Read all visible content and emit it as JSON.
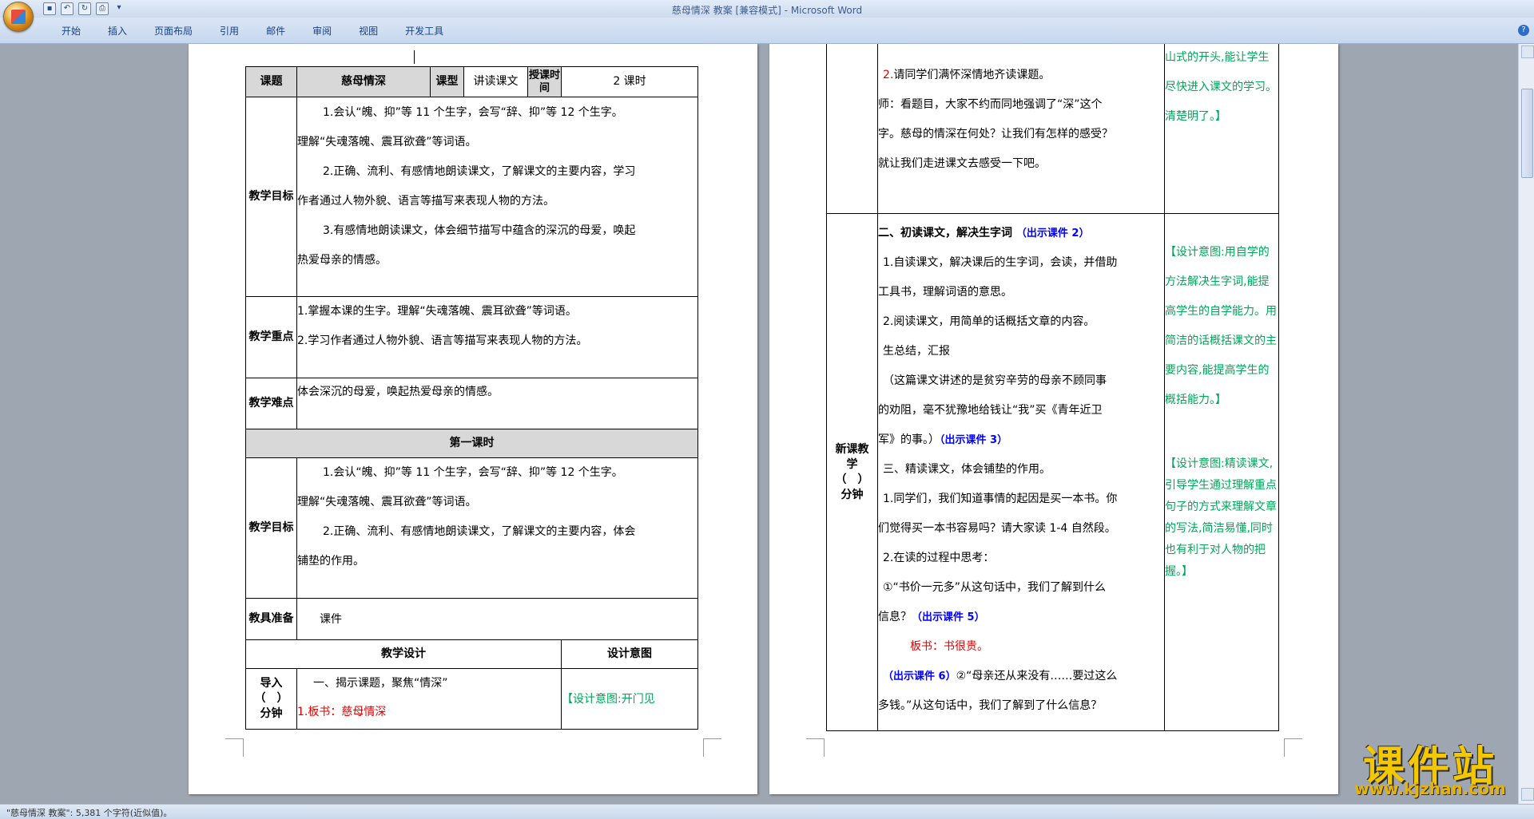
{
  "app": {
    "window_title": "慈母情深 教案 [兼容模式] - Microsoft Word",
    "tabs": [
      "开始",
      "插入",
      "页面布局",
      "引用",
      "邮件",
      "审阅",
      "视图",
      "开发工具"
    ],
    "help": "?",
    "status": "\"慈母情深 教案\": 5,381 个字符(近似值)。"
  },
  "watermark": {
    "cn": "课件站",
    "url": "www.kjzhan.com"
  },
  "left": {
    "header": {
      "c1": "课题",
      "c2": "慈母情深",
      "c3": "课型",
      "c4": "讲读课文",
      "c5": "授课时间",
      "c6": "2 课时"
    },
    "goals_label": "教学目标",
    "goals": [
      "1.会认“魄、抑”等 11 个生字，会写“辞、抑”等 12 个生字。",
      "理解“失魂落魄、震耳欲聋”等词语。",
      "2.正确、流利、有感情地朗读课文，了解课文的主要内容，学习",
      "作者通过人物外貌、语言等描写来表现人物的方法。",
      "3.有感情地朗读课文，体会细节描写中蕴含的深沉的母爱，唤起",
      "热爱母亲的情感。"
    ],
    "key_label": "教学重点",
    "key": [
      "1.掌握本课的生字。理解“失魂落魄、震耳欲聋”等词语。",
      "2.学习作者通过人物外貌、语言等描写来表现人物的方法。"
    ],
    "diff_label": "教学难点",
    "diff": "体会深沉的母爱，唤起热爱母亲的情感。",
    "lesson1": "第一课时",
    "goals2_label": "教学目标",
    "goals2": [
      "1.会认“魄、抑”等 11 个生字，会写“辞、抑”等 12 个生字。",
      "理解“失魂落魄、震耳欲聋”等词语。",
      "2.正确、流利、有感情地朗读课文，了解课文的主要内容，体会",
      "铺垫的作用。"
    ],
    "tools_label": "教具准备",
    "tools": "课件",
    "design_label": "教学设计",
    "intent_label": "设计意图",
    "intro_label": "导入（　）分钟",
    "intro_text": "一、揭示课题，聚焦“情深”",
    "intro_num": "1.",
    "intro_board": "板书：慈母情深",
    "intro_intent": "【设计意图:开门见"
  },
  "right": {
    "top_num": "2.",
    "top_lines": [
      "请同学们满怀深情地齐读课题。",
      "师：看题目，大家不约而同地强调了“深”这个",
      "字。慈母的情深在何处？让我们有怎样的感受？",
      "就让我们走进课文去感受一下吧。"
    ],
    "top_intent": "山式的开头,能让学生尽快进入课文的学习。清楚明了。】",
    "new_label": "新课教学（　）分钟",
    "sec2_title": "二、初读课文，解决生字词",
    "sec2_tag": "（出示课件 2）",
    "sec2_lines": [
      "1.自读课文，解决课后的生字词，会读，并借助",
      "工具书，理解词语的意思。",
      "2.阅读课文，用简单的话概括文章的内容。",
      "生总结，汇报",
      "（这篇课文讲述的是贫穷辛劳的母亲不顾同事",
      "的劝阻，毫不犹豫地给钱让“我”买《青年近卫"
    ],
    "sec2_last": "军》的事。）",
    "sec2_tag2": "（出示课件 3）",
    "sec3_title": "三、精读课文，体会铺垫的作用。",
    "sec3_lines": [
      "1.同学们，我们知道事情的起因是买一本书。你",
      "们觉得买一本书容易吗？请大家读 1-4 自然段。",
      "2.在读的过程中思考：",
      "①“书价一元多”从这句话中，我们了解到什么"
    ],
    "sec3_info": "信息？",
    "sec3_tag5": "（出示课件 5）",
    "board2": "板书：书很贵。",
    "sec3_tag6": "（出示课件 6）",
    "sec3_q2": "②“母亲还从来没有……要过这么",
    "sec3_q2b": "多钱。”从这句话中，我们了解到了什么信息？",
    "intent2": "【设计意图:用自学的方法解决生字词,能提高学生的自学能力。用简洁的话概括课文的主要内容,能提高学生的概括能力。】",
    "intent3": "【设计意图:精读课文,引导学生通过理解重点句子的方式来理解文章的写法,简洁易懂,同时也有利于对人物的把握。】"
  }
}
